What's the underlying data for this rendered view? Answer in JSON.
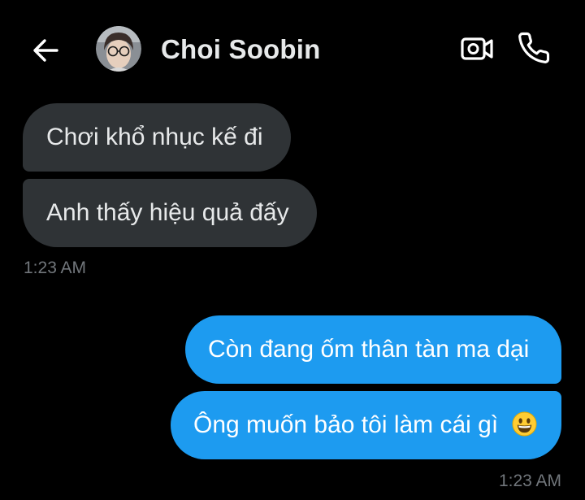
{
  "header": {
    "back_icon": "arrow-left-icon",
    "contact_name": "Choi Soobin",
    "avatar_icon": "profile-photo",
    "video_icon": "video-call-icon",
    "phone_icon": "phone-icon"
  },
  "messages": [
    {
      "direction": "incoming",
      "text": "Chơi khổ nhục kế đi"
    },
    {
      "direction": "incoming",
      "text": "Anh thấy hiệu quả đấy"
    },
    {
      "direction": "outgoing",
      "text": "Còn đang ốm thân tàn ma dại"
    },
    {
      "direction": "outgoing",
      "text": "Ông muốn bảo tôi làm cái gì",
      "emoji": "grinning-face-emoji"
    }
  ],
  "timestamps": {
    "incoming": "1:23 AM",
    "outgoing": "1:23 AM"
  },
  "colors": {
    "background": "#000000",
    "incoming_bubble": "#2f3336",
    "outgoing_bubble": "#1d9bf0",
    "timestamp_text": "#71767b",
    "primary_text": "#e7e9ea"
  }
}
